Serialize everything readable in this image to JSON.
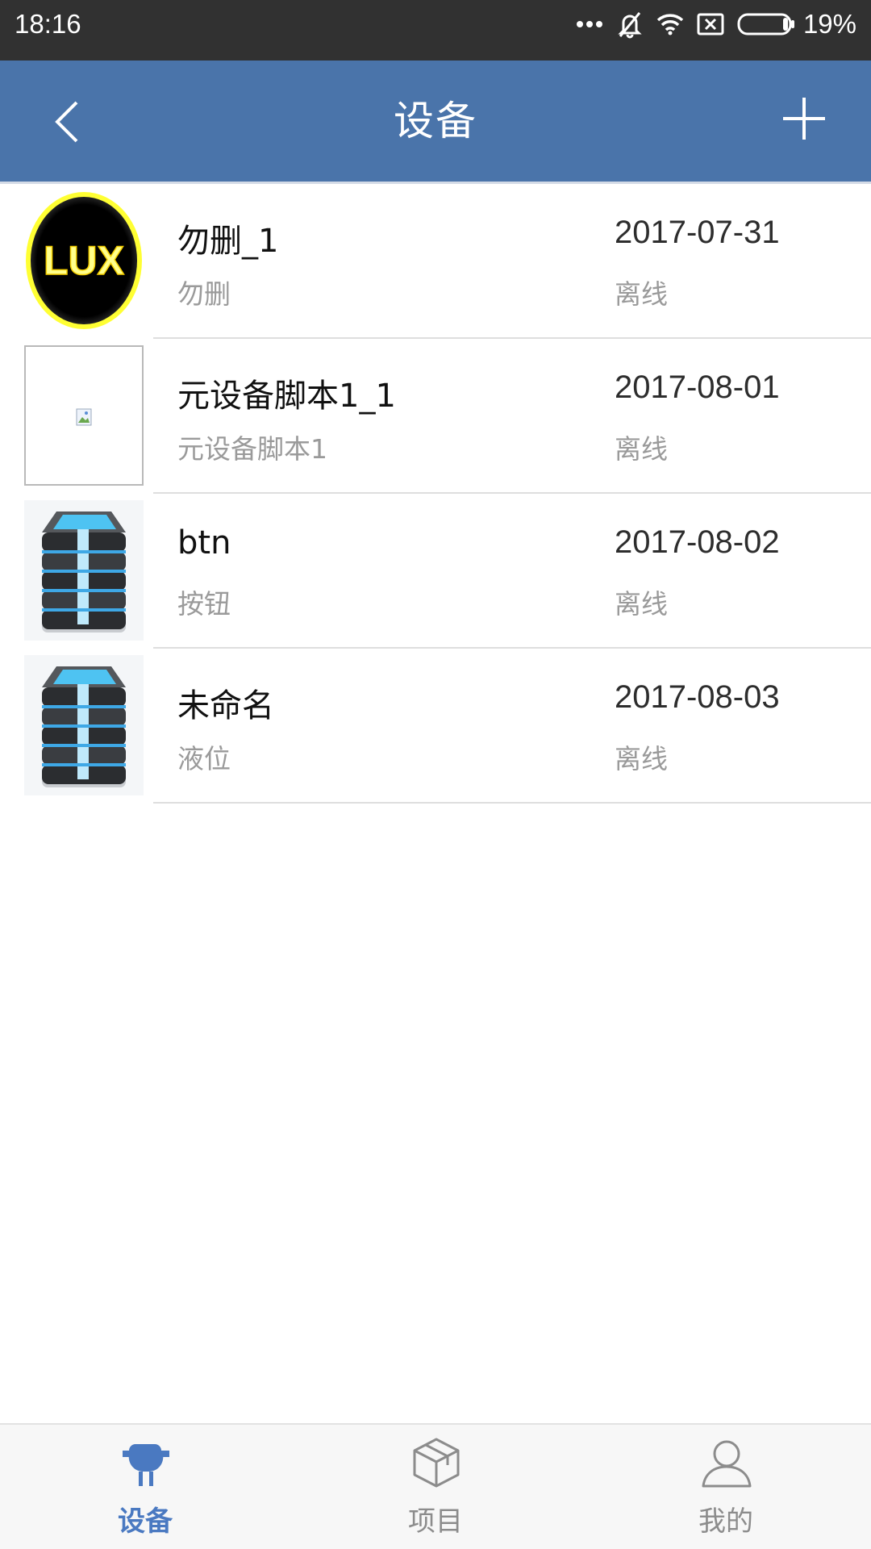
{
  "status_bar": {
    "time": "18:16",
    "battery_text": "19%",
    "icons": [
      "more-dots-icon",
      "bell-muted-icon",
      "wifi-icon",
      "sim-missing-icon",
      "battery-icon"
    ]
  },
  "header": {
    "title": "设备",
    "back_icon": "chevron-left-icon",
    "add_icon": "plus-icon",
    "background_color": "#4a74aa"
  },
  "devices": [
    {
      "name": "勿删_1",
      "type": "勿删",
      "date": "2017-07-31",
      "status": "离线",
      "thumbnail": "lux-badge"
    },
    {
      "name": "元设备脚本1_1",
      "type": "元设备脚本1",
      "date": "2017-08-01",
      "status": "离线",
      "thumbnail": "broken-image"
    },
    {
      "name": "btn",
      "type": "按钮",
      "date": "2017-08-02",
      "status": "离线",
      "thumbnail": "server-stack"
    },
    {
      "name": "未命名",
      "type": "液位",
      "date": "2017-08-03",
      "status": "离线",
      "thumbnail": "server-stack"
    }
  ],
  "lux_badge_text": "LUX",
  "tabs": [
    {
      "label": "设备",
      "icon": "plug-icon",
      "active": true
    },
    {
      "label": "项目",
      "icon": "box-icon",
      "active": false
    },
    {
      "label": "我的",
      "icon": "user-icon",
      "active": false
    }
  ],
  "colors": {
    "accent": "#4a79c1",
    "status_bar": "#313131",
    "muted_text": "#9a9a9a"
  }
}
